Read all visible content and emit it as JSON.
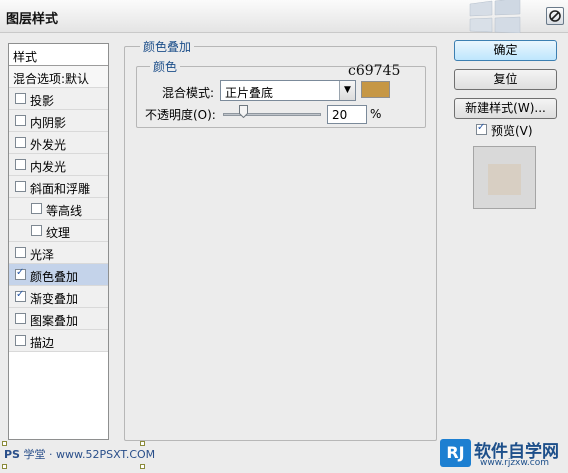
{
  "window": {
    "title": "图层样式"
  },
  "stylelist": {
    "header": "样式",
    "blend_options": "混合选项:默认",
    "items": [
      {
        "label": "投影",
        "checked": false,
        "indent": false,
        "selected": false
      },
      {
        "label": "内阴影",
        "checked": false,
        "indent": false,
        "selected": false
      },
      {
        "label": "外发光",
        "checked": false,
        "indent": false,
        "selected": false
      },
      {
        "label": "内发光",
        "checked": false,
        "indent": false,
        "selected": false
      },
      {
        "label": "斜面和浮雕",
        "checked": false,
        "indent": false,
        "selected": false
      },
      {
        "label": "等高线",
        "checked": false,
        "indent": true,
        "selected": false
      },
      {
        "label": "纹理",
        "checked": false,
        "indent": true,
        "selected": false
      },
      {
        "label": "光泽",
        "checked": false,
        "indent": false,
        "selected": false
      },
      {
        "label": "颜色叠加",
        "checked": true,
        "indent": false,
        "selected": true
      },
      {
        "label": "渐变叠加",
        "checked": true,
        "indent": false,
        "selected": false
      },
      {
        "label": "图案叠加",
        "checked": false,
        "indent": false,
        "selected": false
      },
      {
        "label": "描边",
        "checked": false,
        "indent": false,
        "selected": false
      }
    ]
  },
  "panel": {
    "group_title": "颜色叠加",
    "subgroup_title": "颜色",
    "blend_mode_label": "混合模式:",
    "blend_mode_value": "正片叠底",
    "color_value": "c69745",
    "color_hex": "#c69745",
    "opacity_label": "不透明度(O):",
    "opacity_value": "20",
    "opacity_fraction": 0.2,
    "opacity_unit": "%"
  },
  "buttons": {
    "ok": "确定",
    "reset": "复位",
    "new_style": "新建样式(W)...",
    "preview_label": "预览(V)",
    "preview_checked": true
  },
  "preview": {
    "swatch_color": "#d8cfc3"
  },
  "watermark_left": {
    "logo": "PS",
    "text": "学堂 · www.52PSXT.COM"
  },
  "watermark_right": {
    "logo": "RJ",
    "brand": "软件自学网",
    "url": "www.rjzxw.com"
  }
}
